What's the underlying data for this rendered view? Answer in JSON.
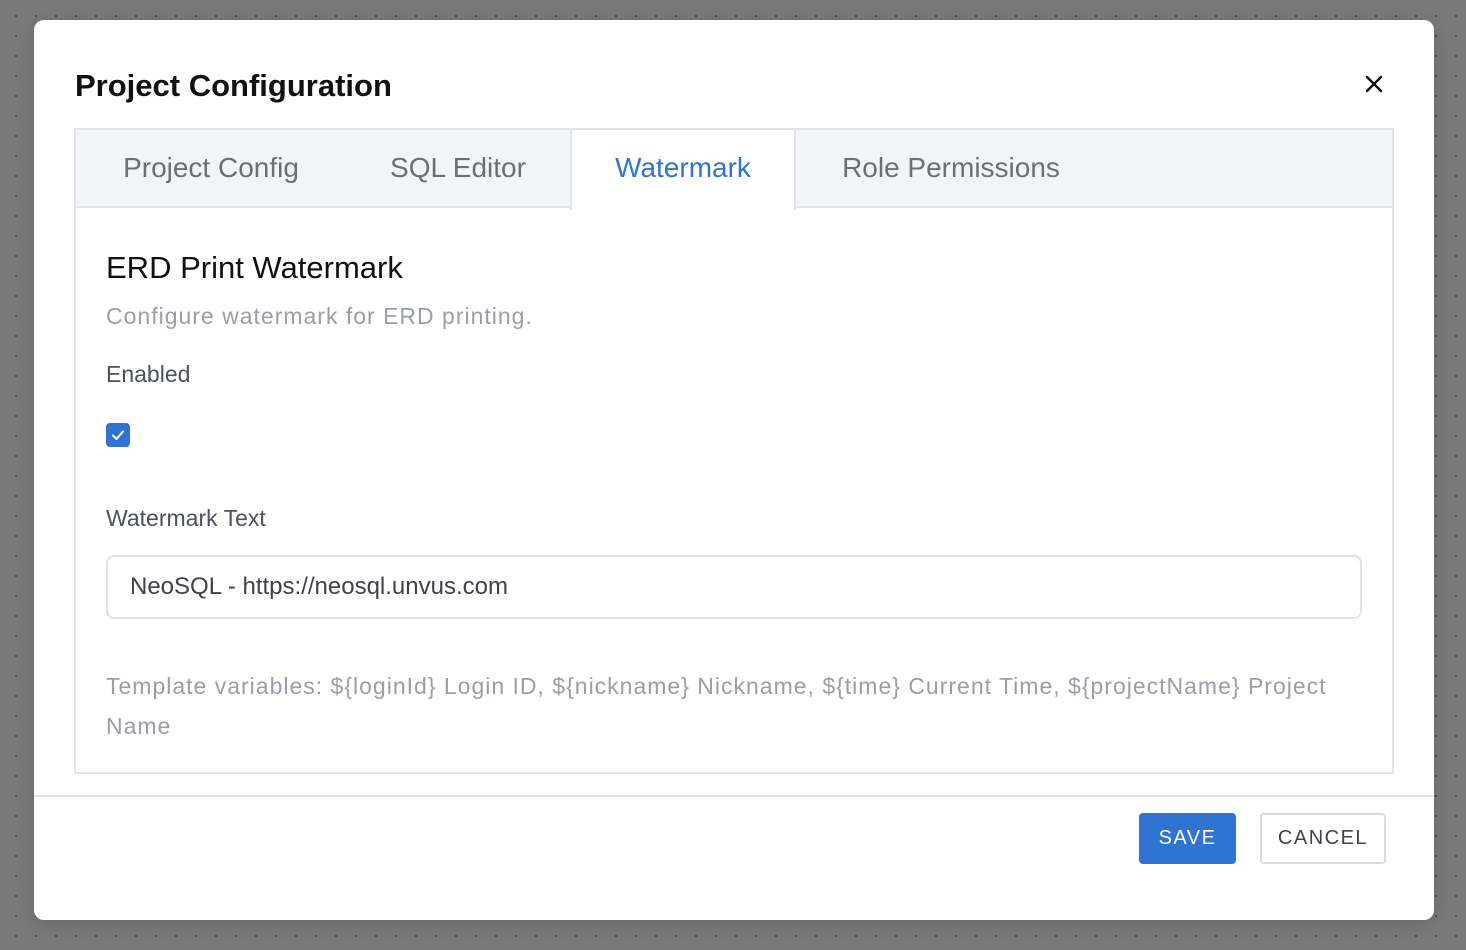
{
  "modal": {
    "title": "Project Configuration",
    "close_icon": "close-icon"
  },
  "tabs": [
    {
      "label": "Project Config",
      "active": false
    },
    {
      "label": "SQL Editor",
      "active": false
    },
    {
      "label": "Watermark",
      "active": true
    },
    {
      "label": "Role Permissions",
      "active": false
    }
  ],
  "watermark": {
    "section_title": "ERD Print Watermark",
    "description": "Configure watermark for ERD printing.",
    "enabled_label": "Enabled",
    "enabled": true,
    "text_label": "Watermark Text",
    "text_value": "NeoSQL - https://neosql.unvus.com",
    "hint": "Template variables: ${loginId} Login ID, ${nickname} Nickname, ${time} Current Time, ${projectName} Project Name"
  },
  "footer": {
    "save_label": "SAVE",
    "cancel_label": "CANCEL"
  },
  "colors": {
    "accent": "#2f74d0",
    "overlay": "#7a7a7a",
    "muted_text": "#9a9ea5"
  }
}
